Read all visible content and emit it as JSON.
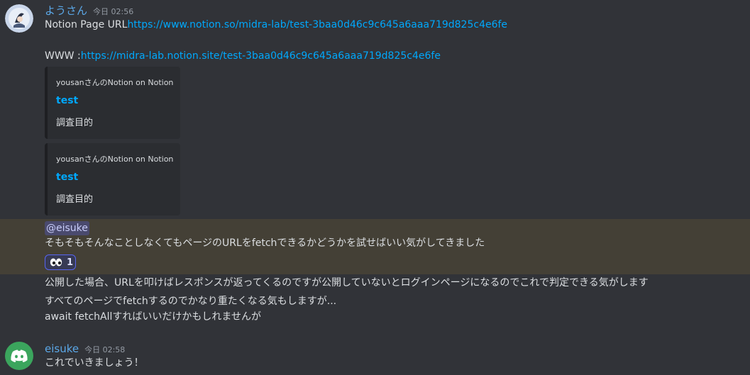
{
  "messages": [
    {
      "author": "ようさん",
      "time": "今日 02:56",
      "line1_prefix": "Notion Page URL",
      "line1_link": "https://www.notion.so/midra-lab/test-3baa0d46c9c645a6aaa719d825c4e6fe",
      "line2_prefix": "WWW :",
      "line2_link": "https://midra-lab.notion.site/test-3baa0d46c9c645a6aaa719d825c4e6fe",
      "embeds": [
        {
          "provider": "yousanさんのNotion on Notion",
          "title": "test",
          "description": "調査目的"
        },
        {
          "provider": "yousanさんのNotion on Notion",
          "title": "test",
          "description": "調査目的"
        }
      ],
      "mention": "@eisuke",
      "highlighted_text": "そもそもそんなことしなくてもページのURLをfetchできるかどうかを試せばいい気がしてきました",
      "reaction": {
        "emoji_icon": "eyes-icon",
        "count": "1"
      },
      "followups": [
        "公開した場合、URLを叩けばレスポンスが返ってくるのですが公開していないとログインページになるのでこれで判定できる気がします",
        "すべてのページでfetchするのでかなり重たくなる気もしますが...",
        "await fetchAllすればいいだけかもしれませんが"
      ]
    },
    {
      "author": "eisuke",
      "time": "今日 02:58",
      "text": "これでいきましょう！",
      "avatar_icon": "discord-icon",
      "avatar_color": "#3ba55d"
    }
  ]
}
